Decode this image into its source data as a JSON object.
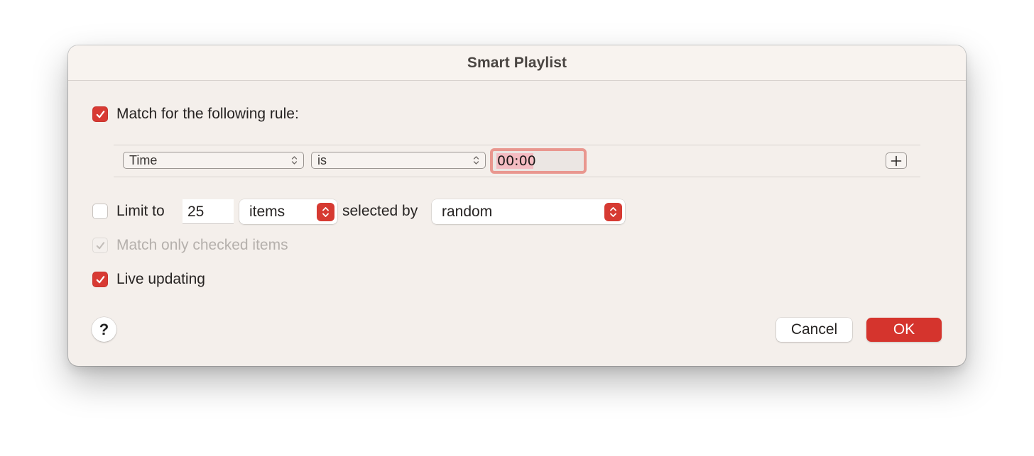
{
  "dialog": {
    "title": "Smart Playlist",
    "accent_color": "#d83a33"
  },
  "match_rule": {
    "label": "Match for the following rule:",
    "checked": true
  },
  "rule": {
    "field": "Time",
    "operator": "is",
    "value": "00:00",
    "add_icon": "plus-icon"
  },
  "limit": {
    "label": "Limit to",
    "checked": false,
    "count": "25",
    "unit": "items",
    "selected_by_label": "selected by",
    "selected_by": "random"
  },
  "match_checked": {
    "label": "Match only checked items",
    "checked": true,
    "disabled": true
  },
  "live_updating": {
    "label": "Live updating",
    "checked": true
  },
  "buttons": {
    "help": "?",
    "cancel": "Cancel",
    "ok": "OK"
  }
}
